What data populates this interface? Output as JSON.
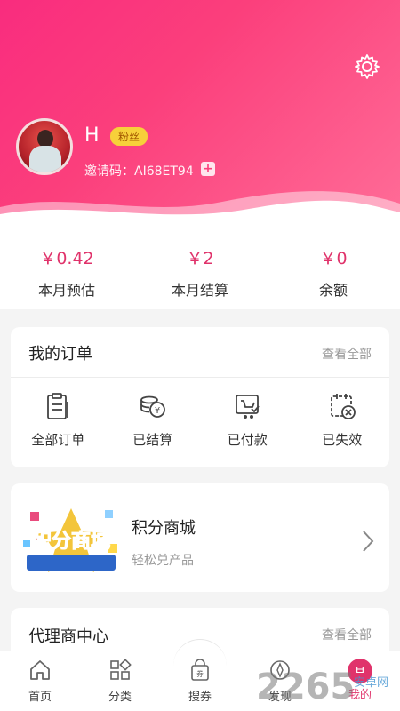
{
  "profile": {
    "name": "H",
    "badge": "粉丝",
    "invite_code": "邀请码：AI68ET94"
  },
  "stats": [
    {
      "value": "￥0.42",
      "label": "本月预估"
    },
    {
      "value": "￥2",
      "label": "本月结算"
    },
    {
      "value": "￥0",
      "label": "余额"
    }
  ],
  "orders": {
    "title": "我的订单",
    "view_all": "查看全部",
    "items": [
      {
        "label": "全部订单",
        "icon": "clipboard-icon"
      },
      {
        "label": "已结算",
        "icon": "coins-icon"
      },
      {
        "label": "已付款",
        "icon": "cart-paid-icon"
      },
      {
        "label": "已失效",
        "icon": "expired-icon"
      }
    ]
  },
  "mall": {
    "title": "积分商城",
    "subtitle": "轻松兑产品",
    "image_text": "积分商城"
  },
  "agent": {
    "title": "代理商中心",
    "view_all": "查看全部"
  },
  "tabs": [
    {
      "label": "首页",
      "icon": "home-icon"
    },
    {
      "label": "分类",
      "icon": "category-icon"
    },
    {
      "label": "搜券",
      "icon": "coupon-bag-icon",
      "icon_text": "券"
    },
    {
      "label": "发现",
      "icon": "discover-icon"
    },
    {
      "label": "我的",
      "icon": "me-icon",
      "icon_text": "ㅂ"
    }
  ],
  "watermark": {
    "text": "2265",
    "sub": "安卓网"
  },
  "colors": {
    "brand": "#f92c7e",
    "accent_text": "#e0336b",
    "badge": "#f7d03a"
  }
}
